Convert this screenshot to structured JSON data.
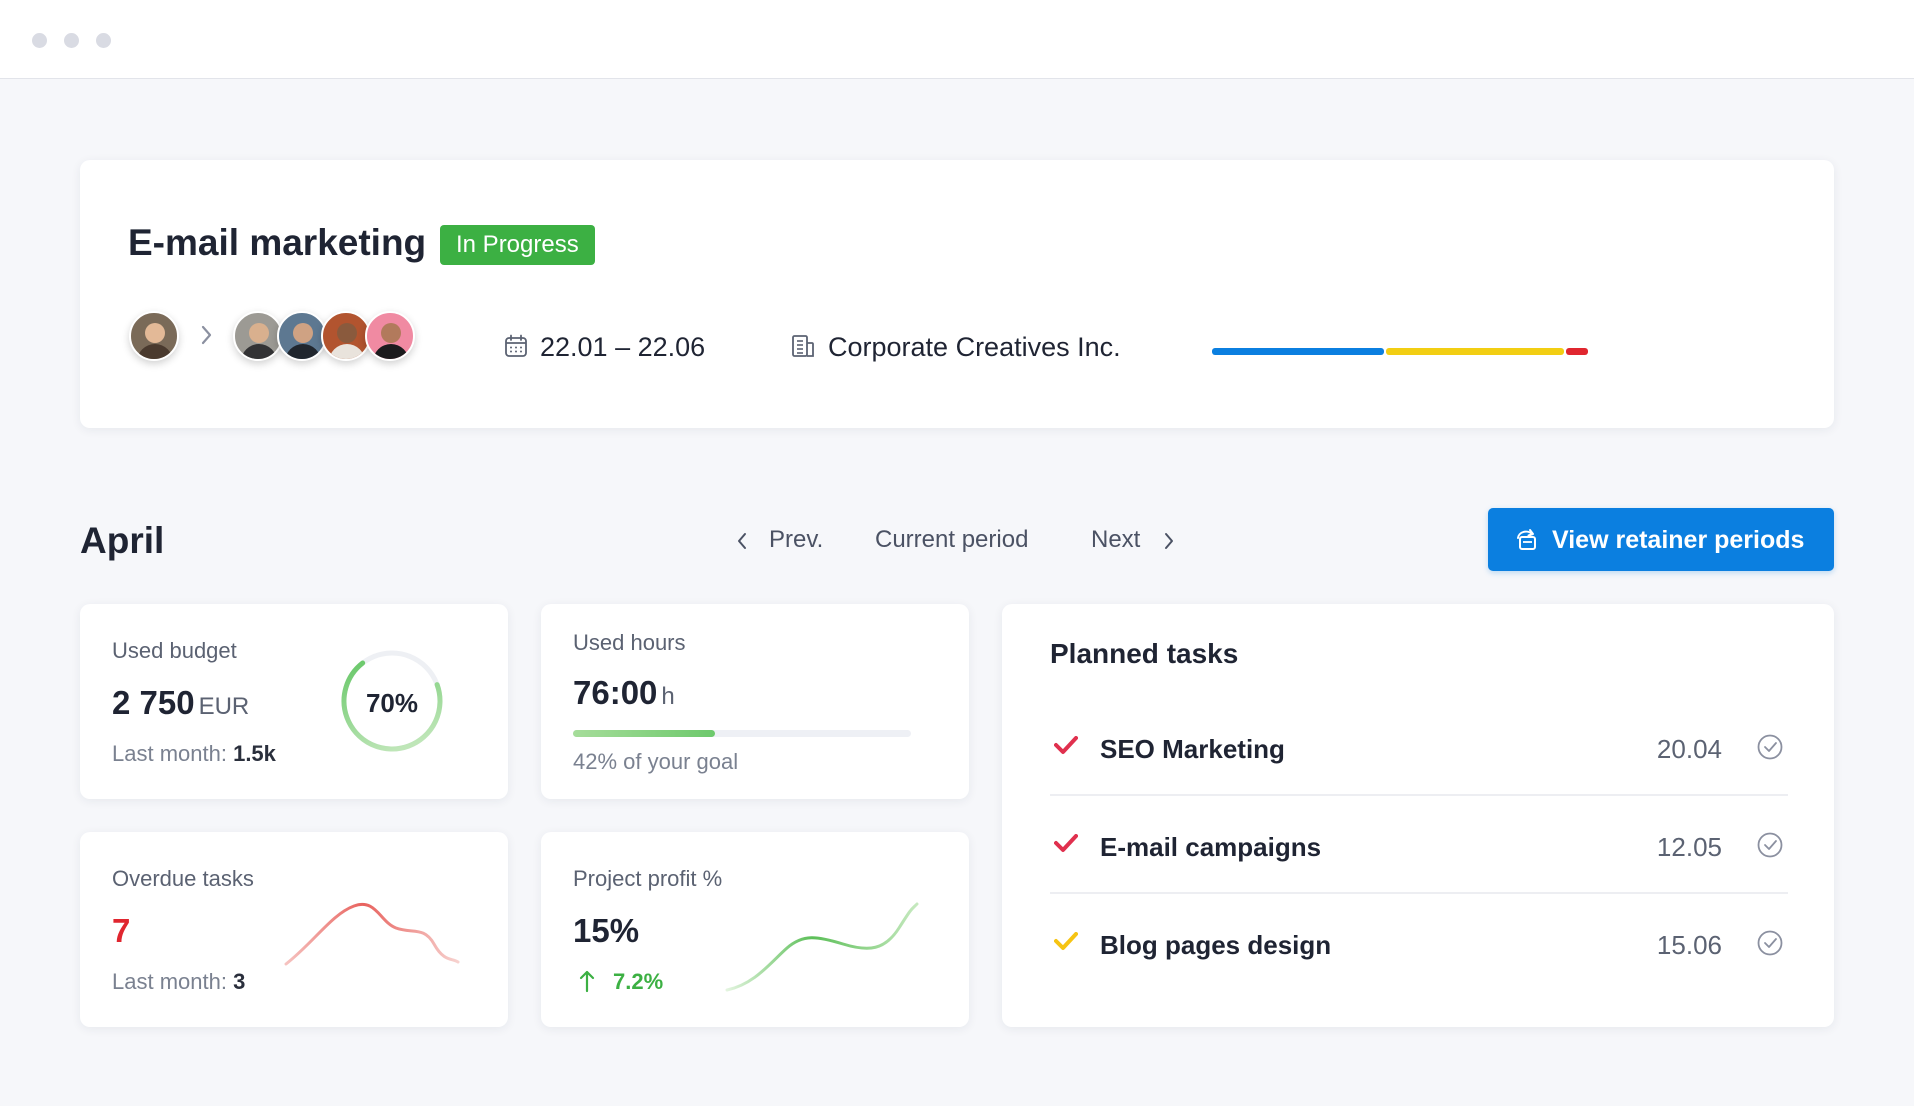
{
  "colors": {
    "accent_blue": "#0b7fe0",
    "status_green": "#3cb043",
    "bar_blue": "#0b7fe0",
    "bar_yellow": "#f2ce13",
    "bar_red": "#e0262f",
    "overdue_red": "#e0262f",
    "positive_green": "#3cb043",
    "check_red": "#e0304e",
    "check_yellow": "#f6c413"
  },
  "project": {
    "title": "E-mail marketing",
    "status": "In Progress",
    "owner_avatar": "avatar-owner",
    "team_avatars": [
      "avatar-member-1",
      "avatar-member-2",
      "avatar-member-3",
      "avatar-member-4"
    ],
    "dates": "22.01 – 22.06",
    "date_icon": "calendar-icon",
    "client": "Corporate Creatives Inc.",
    "client_icon": "building-icon",
    "progress_segments": [
      {
        "name": "blue",
        "fraction": 0.46
      },
      {
        "name": "yellow",
        "fraction": 0.47
      },
      {
        "name": "red",
        "fraction": 0.06
      }
    ]
  },
  "period": {
    "month": "April",
    "prev_label": "Prev.",
    "current_label": "Current period",
    "next_label": "Next",
    "view_button": "View retainer periods",
    "view_button_icon": "retainer-periods-icon"
  },
  "stats": {
    "budget": {
      "label": "Used budget",
      "value": "2 750",
      "unit": "EUR",
      "last_month_label": "Last month:",
      "last_month_value": "1.5k",
      "percent_label": "70%",
      "percent": 70
    },
    "hours": {
      "label": "Used hours",
      "value": "76:00",
      "unit": "h",
      "goal_text": "42% of your goal",
      "goal_percent": 42
    },
    "overdue": {
      "label": "Overdue tasks",
      "value": "7",
      "last_month_label": "Last month:",
      "last_month_value": "3"
    },
    "profit": {
      "label": "Project profit %",
      "value": "15%",
      "change": "7.2%",
      "change_icon": "arrow-up-icon"
    }
  },
  "planned_tasks": {
    "title": "Planned tasks",
    "items": [
      {
        "name": "SEO Marketing",
        "date": "20.04",
        "check_color": "red"
      },
      {
        "name": "E-mail campaigns",
        "date": "12.05",
        "check_color": "red"
      },
      {
        "name": "Blog pages design",
        "date": "15.06",
        "check_color": "yellow"
      }
    ]
  }
}
